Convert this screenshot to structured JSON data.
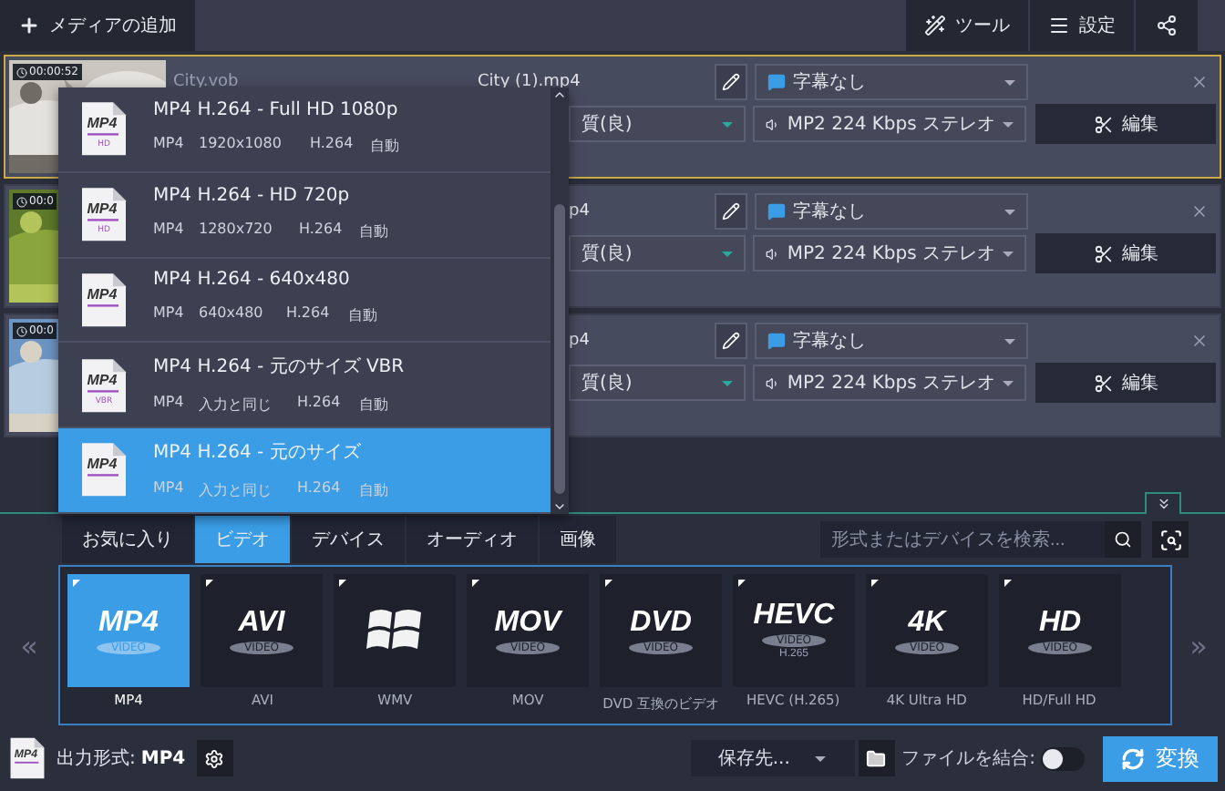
{
  "toolbar": {
    "add_media": "メディアの追加",
    "tools": "ツール",
    "settings": "設定"
  },
  "files": [
    {
      "duration": "00:00:52",
      "input": "City.vob",
      "output": "City (1).mp4",
      "quality": "質(良)",
      "subtitle": "字幕なし",
      "audio": "MP2 224 Kbps ステレオ",
      "edit": "編集",
      "selected": true
    },
    {
      "duration": "00:0",
      "output": "p4",
      "quality": "質(良)",
      "subtitle": "字幕なし",
      "audio": "MP2 224 Kbps ステレオ",
      "edit": "編集",
      "selected": false
    },
    {
      "duration": "00:0",
      "output": "p4",
      "quality": "質(良)",
      "subtitle": "字幕なし",
      "audio": "MP2 224 Kbps ステレオ",
      "edit": "編集",
      "selected": false
    }
  ],
  "format_menu": {
    "items": [
      {
        "title": "MP4 H.264 - Full HD 1080p",
        "icon_label": "MP4",
        "icon_sub": "HD",
        "container": "MP4",
        "resolution": "1920x1080",
        "codec": "H.264",
        "bitrate": "自動",
        "selected": false
      },
      {
        "title": "MP4 H.264 - HD 720p",
        "icon_label": "MP4",
        "icon_sub": "HD",
        "container": "MP4",
        "resolution": "1280x720",
        "codec": "H.264",
        "bitrate": "自動",
        "selected": false
      },
      {
        "title": "MP4 H.264 - 640x480",
        "icon_label": "MP4",
        "container": "MP4",
        "resolution": "640x480",
        "codec": "H.264",
        "bitrate": "自動",
        "selected": false
      },
      {
        "title": "MP4 H.264 - 元のサイズ VBR",
        "icon_label": "MP4",
        "icon_sub": "VBR",
        "container": "MP4",
        "resolution": "入力と同じ",
        "codec": "H.264",
        "bitrate": "自動",
        "selected": false
      },
      {
        "title": "MP4 H.264 - 元のサイズ",
        "icon_label": "MP4",
        "container": "MP4",
        "resolution": "入力と同じ",
        "codec": "H.264",
        "bitrate": "自動",
        "selected": true
      }
    ]
  },
  "format_tabs": [
    {
      "label": "お気に入り",
      "selected": false
    },
    {
      "label": "ビデオ",
      "selected": true
    },
    {
      "label": "デバイス",
      "selected": false
    },
    {
      "label": "オーディオ",
      "selected": false
    },
    {
      "label": "画像",
      "selected": false
    }
  ],
  "search": {
    "placeholder": "形式またはデバイスを検索..."
  },
  "nav": {
    "prev": "«",
    "next": "»"
  },
  "formats": [
    {
      "kind": "text",
      "logo": "MP4",
      "sub": "VIDEO",
      "label": "MP4",
      "selected": true
    },
    {
      "kind": "text",
      "logo": "AVI",
      "sub": "VIDEO",
      "label": "AVI",
      "selected": false
    },
    {
      "kind": "windows",
      "label": "WMV",
      "selected": false
    },
    {
      "kind": "text",
      "logo": "MOV",
      "sub": "VIDEO",
      "label": "MOV",
      "selected": false
    },
    {
      "kind": "text",
      "logo": "DVD",
      "sub": "VIDEO",
      "label": "DVD 互換のビデオ",
      "selected": false
    },
    {
      "kind": "text",
      "logo": "HEVC",
      "sub": "VIDEO",
      "sub2": "H.265",
      "label": "HEVC (H.265)",
      "selected": false
    },
    {
      "kind": "text",
      "logo": "4K",
      "sub": "VIDEO",
      "label": "4K Ultra HD",
      "selected": false
    },
    {
      "kind": "text",
      "logo": "HD",
      "sub": "VIDEO",
      "label": "HD/Full HD",
      "selected": false
    }
  ],
  "output": {
    "icon_label": "MP4",
    "label": "出力形式:",
    "format": "MP4"
  },
  "save_to": "保存先...",
  "merge": {
    "label": "ファイルを結合:",
    "on": false
  },
  "convert": "変換"
}
